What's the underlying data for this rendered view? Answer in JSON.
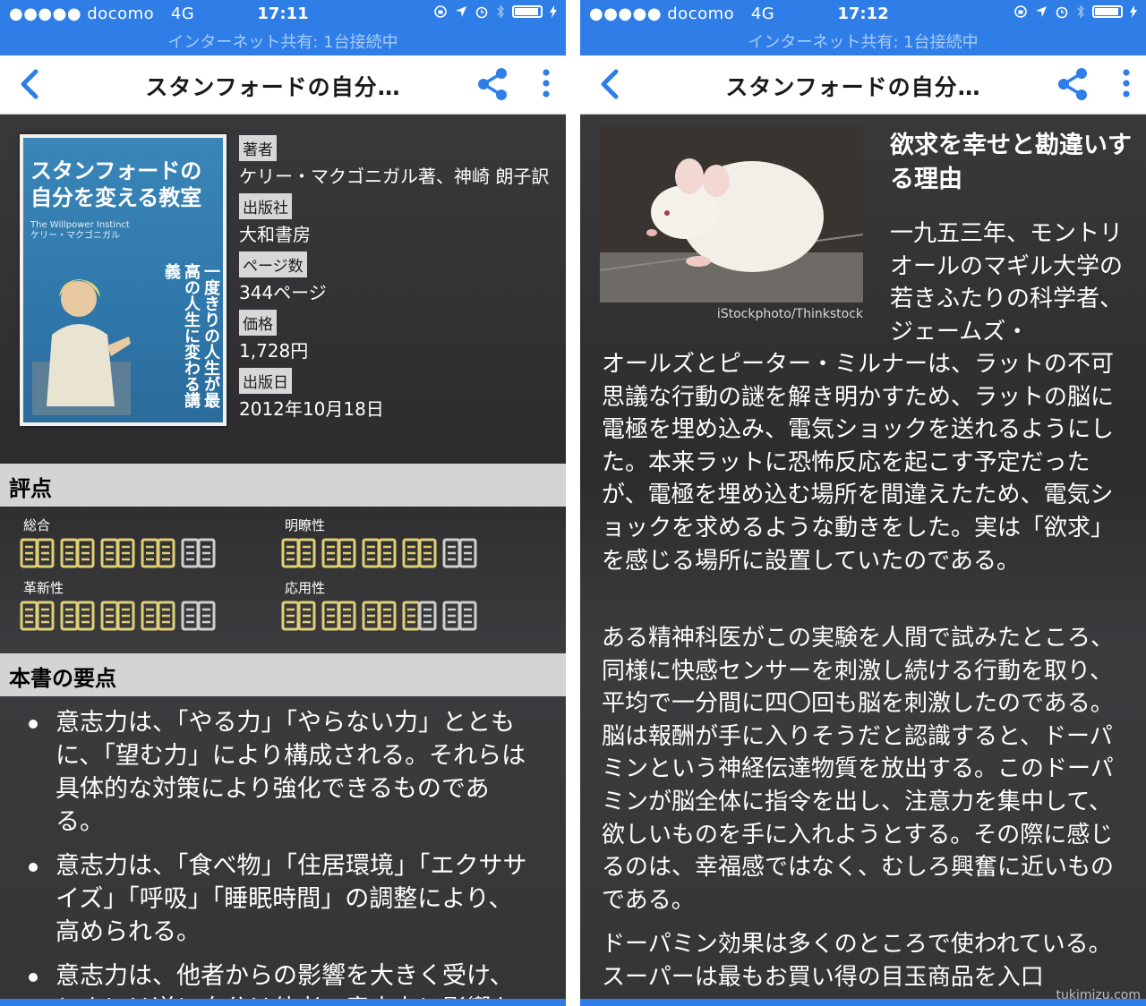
{
  "status_bar": {
    "left": {
      "carrier": "●●●●● docomo",
      "network": "4G",
      "time": "17:11",
      "sharing": "インターネット共有: 1台接続中"
    },
    "right": {
      "carrier": "●●●●● docomo",
      "network": "4G",
      "time": "17:12",
      "sharing": "インターネット共有: 1台接続中"
    }
  },
  "navbar": {
    "title": "スタンフォードの自分…"
  },
  "book": {
    "cover": {
      "title_line1": "スタンフォードの",
      "title_line2": "自分を変える教室",
      "english": "The Willpower Instinct",
      "author": "ケリー・マクゴニガル",
      "vertical": "一度きりの人生が最高の人生に変わる講義"
    },
    "meta": [
      {
        "label": "著者",
        "value": "ケリー・マクゴニガル著、神崎 朗子訳"
      },
      {
        "label": "出版社",
        "value": "大和書房"
      },
      {
        "label": "ページ数",
        "value": "344ページ"
      },
      {
        "label": "価格",
        "value": "1,728円"
      },
      {
        "label": "出版日",
        "value": "2012年10月18日"
      }
    ]
  },
  "ratings": {
    "header": "評点",
    "items": [
      {
        "label": "総合",
        "score": 4,
        "max": 5
      },
      {
        "label": "明瞭性",
        "score": 4,
        "max": 5
      },
      {
        "label": "革新性",
        "score": 4,
        "max": 5
      },
      {
        "label": "応用性",
        "score": 3.5,
        "max": 5
      }
    ],
    "colors": {
      "filled": "#e0cf73",
      "empty": "#cfcfcf"
    }
  },
  "points": {
    "header": "本書の要点",
    "items": [
      "意志力は、「やる力」「やらない力」とともに、「望む力」により構成される。それらは具体的な対策により強化できるものである。",
      "意志力は、「食べ物」「住居環境」「エクササイズ」「呼吸」「睡眠時間」の調整により、高められる。",
      "意志力は、他者からの影響を大きく受け、ときには逆に自分は他者の意志力に影響を"
    ]
  },
  "article": {
    "photo_credit": "iStockphoto/Thinkstock",
    "heading": "欲求を幸せと勘違いする理由",
    "p1_start": "一九五三年、モントリオールのマギル大学の若きふたりの科学者、ジェームズ・",
    "p1_rest": "オールズとピーター・ミルナーは、ラットの不可思議な行動の謎を解き明かすため、ラットの脳に電極を埋め込み、電気ショックを送れるようにした。本来ラットに恐怖反応を起こす予定だったが、電極を埋め込む場所を間違えたため、電気ショックを求めるような動きをした。実は「欲求」を感じる場所に設置していたのである。",
    "p2": "ある精神科医がこの実験を人間で試みたところ、同様に快感センサーを刺激し続ける行動を取り、平均で一分間に四〇回も脳を刺激したのである。脳は報酬が手に入りそうだと認識すると、ドーパミンという神経伝達物質を放出する。このドーパミンが脳全体に指令を出し、注意力を集中して、欲しいものを手に入れようとする。その際に感じるのは、幸福感ではなく、むしろ興奮に近いものである。",
    "p3": "ドーパミン効果は多くのところで使われている。スーパーは最もお買い得の目玉商品を入口"
  },
  "watermark": "tukimizu.com",
  "accent_color": "#2f7ee8"
}
